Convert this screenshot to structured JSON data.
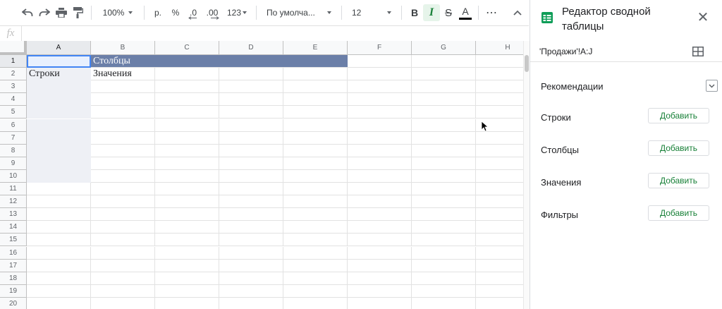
{
  "toolbar": {
    "zoom": "100%",
    "currency": "р.",
    "percent": "%",
    "decrease_decimals": ".0",
    "increase_decimals": ".00",
    "more_formats": "123",
    "font_family": "По умолча...",
    "font_size": "12",
    "bold": "B",
    "italic": "I",
    "strike": "S",
    "text_color": "A",
    "more": "⋯",
    "icons": [
      "undo-icon",
      "redo-icon",
      "print-icon",
      "paint-format-icon",
      "collapse-chevron-icon"
    ]
  },
  "formula_bar": {
    "label": "fx",
    "value": ""
  },
  "grid": {
    "columns": [
      "A",
      "B",
      "C",
      "D",
      "E",
      "F",
      "G",
      "H"
    ],
    "rows": [
      "1",
      "2",
      "3",
      "4",
      "5",
      "6",
      "7",
      "8",
      "9",
      "10",
      "11",
      "12",
      "13",
      "14",
      "15",
      "16",
      "17",
      "18",
      "19",
      "20"
    ],
    "cells": {
      "B1": "Столбцы",
      "A2": "Строки",
      "B2": "Значения"
    },
    "colors": {
      "pivot_header": "#6b7fa8",
      "pivot_rows": "#eef0f5",
      "selection": "#4285f4"
    }
  },
  "panel": {
    "title": "Редактор сводной таблицы",
    "range": "'Продажи'!A:J",
    "recommendations": "Рекомендации",
    "sections": [
      {
        "label": "Строки",
        "button": "Добавить"
      },
      {
        "label": "Столбцы",
        "button": "Добавить"
      },
      {
        "label": "Значения",
        "button": "Добавить"
      },
      {
        "label": "Фильтры",
        "button": "Добавить"
      }
    ],
    "accent": "#188038"
  }
}
